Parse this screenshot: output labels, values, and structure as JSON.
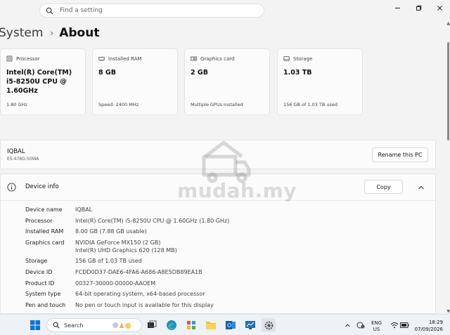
{
  "search": {
    "placeholder": "Find a setting"
  },
  "breadcrumb": {
    "parent": "System",
    "separator": "›",
    "current": "About"
  },
  "cards": [
    {
      "label": "Processor",
      "value": "Intel(R) Core(TM) i5-8250U CPU @ 1.60GHz",
      "sub": "1.80 GHz"
    },
    {
      "label": "Installed RAM",
      "value": "8 GB",
      "sub": "Speed: 2400 MHz"
    },
    {
      "label": "Graphics card",
      "value": "2 GB",
      "sub": "Multiple GPUs installed"
    },
    {
      "label": "Storage",
      "value": "1.03 TB",
      "sub": "156 GB of 1.03 TB used"
    }
  ],
  "pc": {
    "name": "IQBAL",
    "model": "E5-476G-50WA",
    "rename_label": "Rename this PC"
  },
  "device_info": {
    "title": "Device info",
    "copy_label": "Copy",
    "rows": [
      {
        "key": "Device name",
        "value": "IQBAL"
      },
      {
        "key": "Processor",
        "value": "Intel(R) Core(TM) i5-8250U CPU @ 1.60GHz (1.80 GHz)"
      },
      {
        "key": "Installed RAM",
        "value": "8.00 GB (7.88 GB usable)"
      },
      {
        "key": "Graphics card",
        "value": "NVIDIA GeForce MX150 (2 GB)",
        "value2": "Intel(R) UHD Graphics 620 (128 MB)"
      },
      {
        "key": "Storage",
        "value": "156 GB of 1.03 TB used"
      },
      {
        "key": "Device ID",
        "value": "FCDD0D37-DAE6-4FA6-A686-A8E5DB89EA1B"
      },
      {
        "key": "Product ID",
        "value": "00327-30000-00000-AAOEM"
      },
      {
        "key": "System type",
        "value": "64-bit operating system, x64-based processor"
      },
      {
        "key": "Pen and touch",
        "value": "No pen or touch input is available for this display"
      }
    ]
  },
  "watermark": "mudah.my",
  "taskbar": {
    "search_label": "Search",
    "lang": "ENG",
    "region": "US",
    "time": "18:29",
    "date": "07/09/2026"
  },
  "colors": {
    "accent": "#0067c0",
    "card_bg": "#fbfbfb",
    "page_bg": "#f3f3f3"
  }
}
